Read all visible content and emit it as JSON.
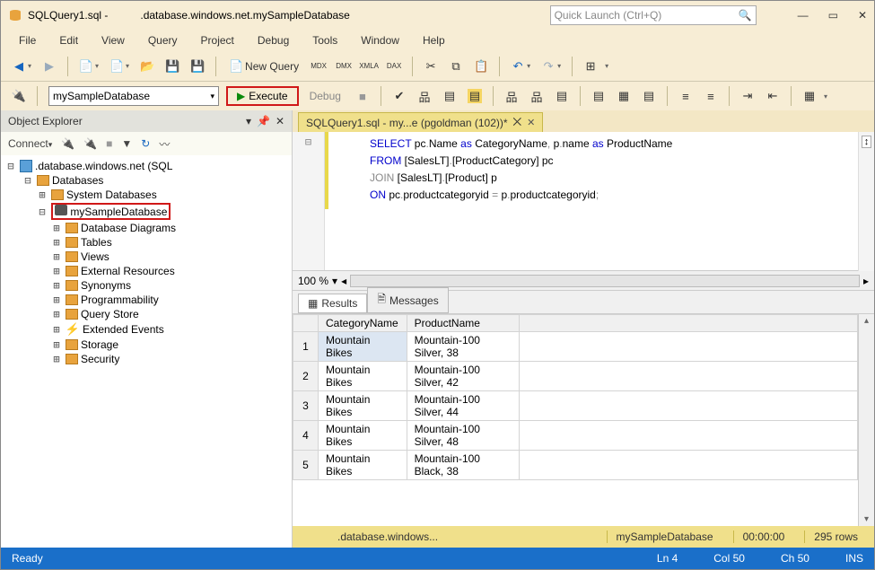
{
  "titlebar": {
    "doc_name": "SQLQuery1.sql -",
    "server": ".database.windows.net.mySampleDatabase",
    "quick_launch_placeholder": "Quick Launch (Ctrl+Q)"
  },
  "menu": [
    "File",
    "Edit",
    "View",
    "Query",
    "Project",
    "Debug",
    "Tools",
    "Window",
    "Help"
  ],
  "toolbar1": {
    "new_query": "New Query"
  },
  "toolbar2": {
    "db_combo": "mySampleDatabase",
    "execute": "Execute",
    "debug": "Debug"
  },
  "object_explorer": {
    "title": "Object Explorer",
    "connect": "Connect",
    "server_label": ".database.windows.net (SQL",
    "nodes": {
      "databases": "Databases",
      "sysdb": "System Databases",
      "mydb": "mySampleDatabase",
      "children": [
        "Database Diagrams",
        "Tables",
        "Views",
        "External Resources",
        "Synonyms",
        "Programmability",
        "Query Store",
        "Extended Events",
        "Storage",
        "Security"
      ]
    }
  },
  "editor_tab": {
    "label": "SQLQuery1.sql - my...e (pgoldman (102))*"
  },
  "sql": {
    "l1a": "SELECT",
    "l1b": " pc",
    "l1c": "Name ",
    "l1d": "as",
    "l1e": " CategoryName",
    "l1f": " p",
    "l1g": "name ",
    "l1h": "as",
    "l1i": " ProductName",
    "l2a": "FROM",
    "l2b": " [SalesLT]",
    "l2c": "[ProductCategory] pc",
    "l3a": "JOIN",
    "l3b": " [SalesLT]",
    "l3c": "[Product] p",
    "l4a": "ON",
    "l4b": " pc",
    "l4c": "productcategoryid ",
    "l4d": " p",
    "l4e": "productcategoryid",
    "dot": ".",
    "comma": ",",
    "eq": "=",
    "semi": ";"
  },
  "zoom": "100 %",
  "results": {
    "tab_results": "Results",
    "tab_messages": "Messages",
    "columns": [
      "",
      "CategoryName",
      "ProductName"
    ],
    "rows": [
      [
        "1",
        "Mountain Bikes",
        "Mountain-100 Silver, 38"
      ],
      [
        "2",
        "Mountain Bikes",
        "Mountain-100 Silver, 42"
      ],
      [
        "3",
        "Mountain Bikes",
        "Mountain-100 Silver, 44"
      ],
      [
        "4",
        "Mountain Bikes",
        "Mountain-100 Silver, 48"
      ],
      [
        "5",
        "Mountain Bikes",
        "Mountain-100 Black, 38"
      ]
    ]
  },
  "result_status": {
    "server": ".database.windows...",
    "db": "mySampleDatabase",
    "time": "00:00:00",
    "rows": "295 rows"
  },
  "statusbar": {
    "ready": "Ready",
    "ln": "Ln 4",
    "col": "Col 50",
    "ch": "Ch 50",
    "ins": "INS"
  }
}
